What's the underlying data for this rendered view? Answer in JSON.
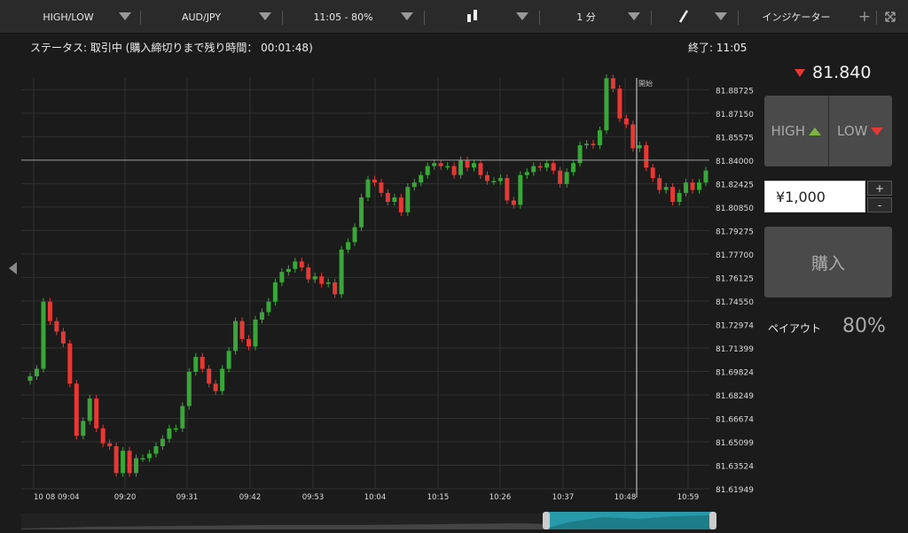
{
  "toolbar": {
    "option_type": "HIGH/LOW",
    "pair": "AUD/JPY",
    "expiry": "11:05 - 80%",
    "chart_type_icon": "candlestick-icon",
    "timeframe": "1 分",
    "draw_icon": "pencil-icon",
    "indicators": "インジケーター",
    "add_icon": "plus-icon",
    "expand_icon": "expand-icon"
  },
  "status": "ステータス: 取引中 (購入締切りまで残り時間： 00:01:48)",
  "end_time": "終了: 11:05",
  "start_label": "開始",
  "trade": {
    "price": "81.840",
    "price_direction": "down",
    "high_label": "HIGH",
    "low_label": "LOW",
    "amount": "¥1,000",
    "plus": "+",
    "minus": "-",
    "buy_label": "購入",
    "payout_label": "ペイアウト",
    "payout_value": "80%"
  },
  "colors": {
    "up": "#3aa63a",
    "down": "#e53935",
    "navigator": "#2aa7b8"
  },
  "chart_data": {
    "type": "candlestick",
    "y_ticks": [
      "81.88725",
      "81.87150",
      "81.85575",
      "81.84000",
      "81.82425",
      "81.80850",
      "81.79275",
      "81.77700",
      "81.76125",
      "81.74550",
      "81.72974",
      "81.71399",
      "81.69824",
      "81.68249",
      "81.66674",
      "81.65099",
      "81.63524",
      "81.61949"
    ],
    "x_ticks": [
      "10 08 09:04",
      "09:20",
      "09:31",
      "09:42",
      "09:53",
      "10:04",
      "10:15",
      "10:26",
      "10:37",
      "10:48",
      "10:59"
    ],
    "current_price_line": 81.84,
    "ylim": [
      81.6195,
      81.8952
    ],
    "closes": [
      81.695,
      81.7,
      81.745,
      81.732,
      81.725,
      81.717,
      81.69,
      81.655,
      81.665,
      81.68,
      81.66,
      81.65,
      81.648,
      81.63,
      81.645,
      81.63,
      81.64,
      81.64,
      81.643,
      81.648,
      81.653,
      81.66,
      81.66,
      81.675,
      81.698,
      81.708,
      81.7,
      81.69,
      81.685,
      81.7,
      81.712,
      81.732,
      81.72,
      81.715,
      81.733,
      81.738,
      81.745,
      81.758,
      81.765,
      81.767,
      81.772,
      81.768,
      81.76,
      81.762,
      81.757,
      81.758,
      81.75,
      81.78,
      81.785,
      81.795,
      81.815,
      81.827,
      81.825,
      81.818,
      81.812,
      81.815,
      81.805,
      81.822,
      81.825,
      81.83,
      81.836,
      81.838,
      81.836,
      81.836,
      81.83,
      81.84,
      81.835,
      81.838,
      81.83,
      81.826,
      81.826,
      81.828,
      81.813,
      81.81,
      81.83,
      81.832,
      81.836,
      81.835,
      81.838,
      81.833,
      81.824,
      81.832,
      81.838,
      81.85,
      81.851,
      81.85,
      81.86,
      81.895,
      81.888,
      81.868,
      81.864,
      81.848,
      81.85,
      81.835,
      81.828,
      81.82,
      81.822,
      81.812,
      81.818,
      81.825,
      81.82,
      81.825,
      81.833
    ]
  }
}
